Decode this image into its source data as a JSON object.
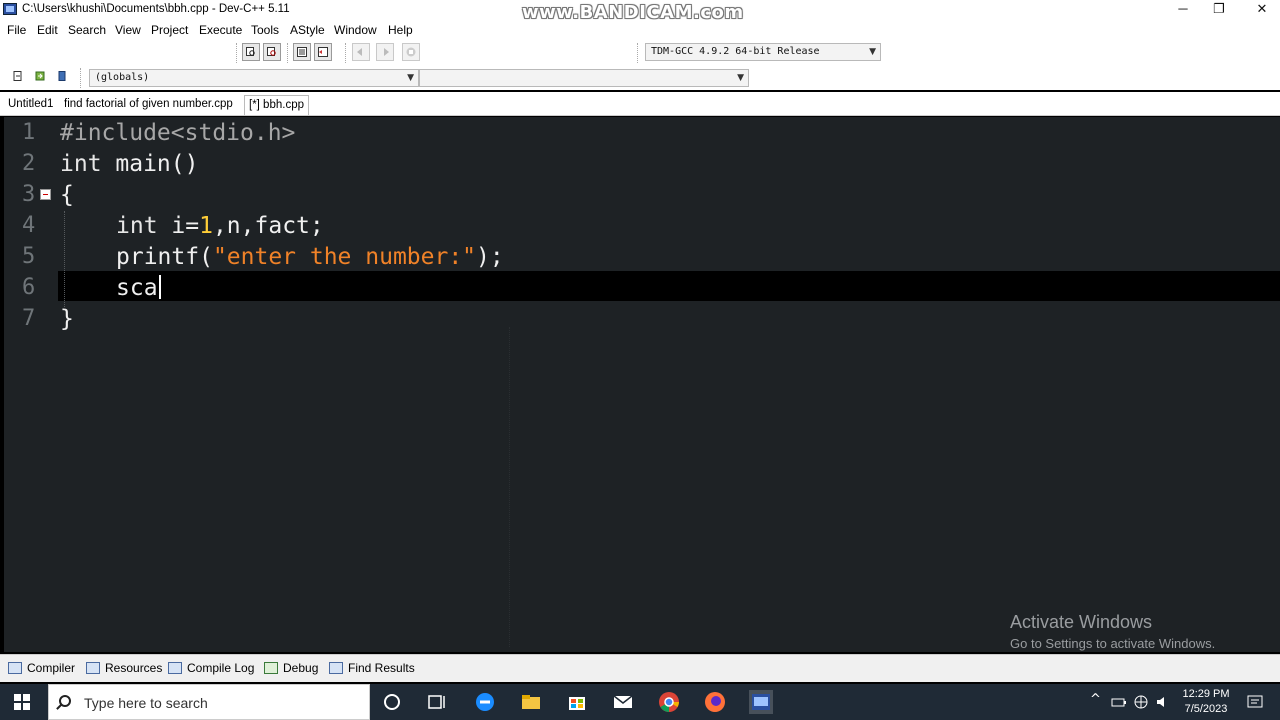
{
  "window": {
    "title": "C:\\Users\\khushi\\Documents\\bbh.cpp - Dev-C++ 5.11",
    "controls": {
      "minimize": "─",
      "maximize": "❐",
      "close": "✕"
    }
  },
  "watermark": "www.BANDICAM.com",
  "menu": [
    "File",
    "Edit",
    "Search",
    "View",
    "Project",
    "Execute",
    "Tools",
    "AStyle",
    "Window",
    "Help"
  ],
  "toolbar": {
    "compiler_select": "TDM-GCC 4.9.2 64-bit Release",
    "scope_select": "(globals)",
    "member_select": ""
  },
  "tabs": [
    {
      "label": "Untitled1",
      "active": false
    },
    {
      "label": "find factorial of  given number.cpp",
      "active": false
    },
    {
      "label": "[*] bbh.cpp",
      "active": true
    }
  ],
  "editor": {
    "line_numbers": [
      "1",
      "2",
      "3",
      "4",
      "5",
      "6",
      "7"
    ],
    "lines": {
      "l1": "#include<stdio.h>",
      "l2_kw": "int",
      "l2_rest": " main()",
      "l3": "{",
      "l4_kw": "int",
      "l4_a": " i=",
      "l4_num": "1",
      "l4_b": ",n,fact;",
      "l5_a": "printf(",
      "l5_str": "\"enter the number:\"",
      "l5_b": ");",
      "l6": "sca",
      "l7": "}"
    },
    "current_line": 6
  },
  "activation": {
    "title": "Activate Windows",
    "subtitle": "Go to Settings to activate Windows."
  },
  "bottom_tabs": [
    "Compiler",
    "Resources",
    "Compile Log",
    "Debug",
    "Find Results"
  ],
  "taskbar": {
    "search_placeholder": "Type here to search",
    "time": "12:29 PM",
    "date": "7/5/2023"
  },
  "colors": {
    "editor_bg": "#1e2225",
    "current_line_bg": "#000000",
    "number_token": "#ffce38",
    "string_token": "#f08228",
    "taskbar_bg": "#1f2a36"
  }
}
